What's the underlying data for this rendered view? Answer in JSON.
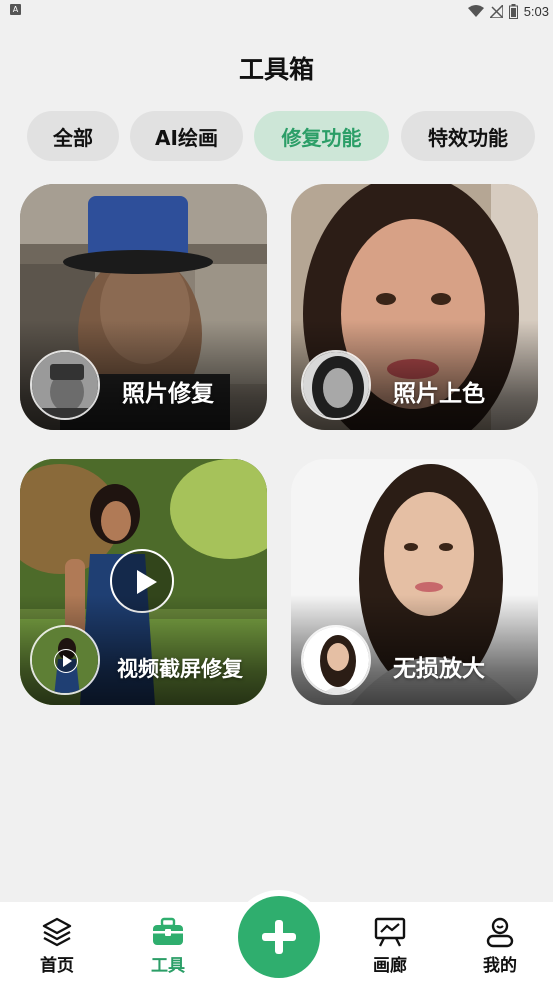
{
  "status_bar": {
    "time": "5:03",
    "app_badge": "A"
  },
  "page": {
    "title": "工具箱"
  },
  "tabs": [
    {
      "label": "全部",
      "active": false
    },
    {
      "label": "AI绘画",
      "active": false
    },
    {
      "label": "修复功能",
      "active": true
    },
    {
      "label": "特效功能",
      "active": false
    }
  ],
  "cards": [
    {
      "label": "照片修复"
    },
    {
      "label": "照片上色"
    },
    {
      "label": "视频截屏修复"
    },
    {
      "label": "无损放大"
    }
  ],
  "bottom_nav": {
    "items": [
      {
        "label": "首页",
        "icon": "layers-icon",
        "active": false
      },
      {
        "label": "工具",
        "icon": "toolbox-icon",
        "active": true
      },
      {
        "label": "画廊",
        "icon": "easel-icon",
        "active": false
      },
      {
        "label": "我的",
        "icon": "profile-icon",
        "active": false
      }
    ],
    "fab_icon": "plus-icon"
  },
  "colors": {
    "accent": "#2fae6e",
    "accent_text": "#2b9e67",
    "active_tab_bg": "#cde6d7",
    "tab_bg": "#e1e1e1"
  }
}
